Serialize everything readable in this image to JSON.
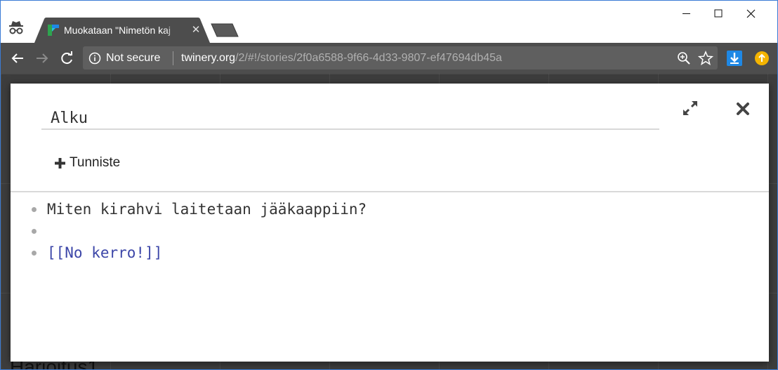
{
  "browser": {
    "tab_title": "Muokataan \"Nimetön kaj",
    "security_label": "Not secure",
    "url_host": "twinery.org",
    "url_path": "/2/#!/stories/2f0a6588-9f66-4d33-9807-ef47694db45a"
  },
  "dialog": {
    "passage_name": "Alku",
    "tag_button_label": "Tunniste",
    "lines": [
      {
        "text": "Miten kirahvi laitetaan jääkaappiin?"
      },
      {
        "text": ""
      },
      {
        "text": "[[No kerro!]]"
      }
    ]
  },
  "background": {
    "story_title": "Harjoitus1"
  },
  "colors": {
    "toolbar": "#4d4d4d",
    "omnibox": "#5f5f5f",
    "link": "#3c46a8",
    "window_border": "#3a7bd5"
  }
}
